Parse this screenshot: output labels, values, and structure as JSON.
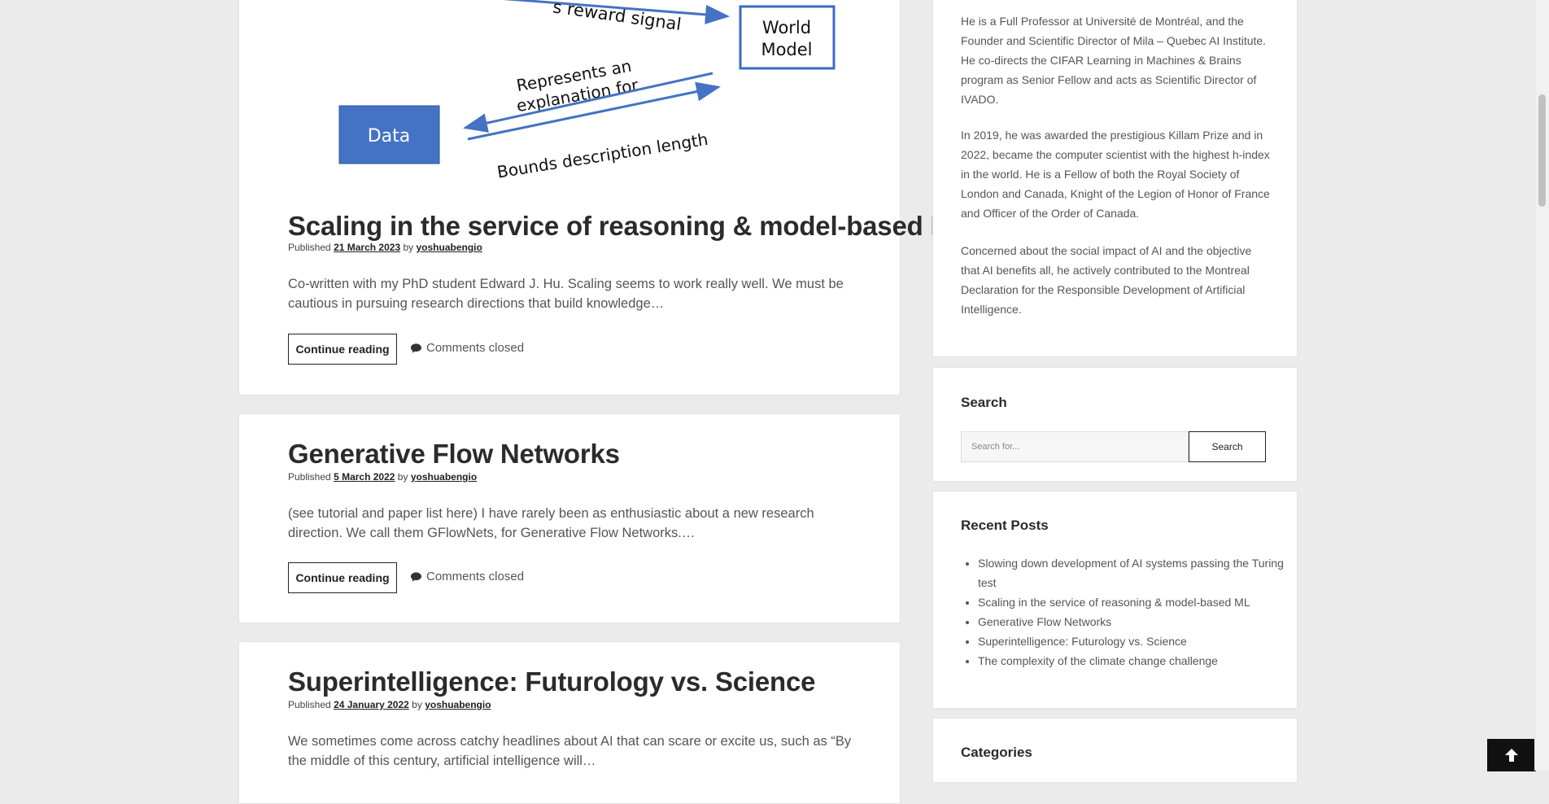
{
  "figure": {
    "world_model_line1": "World",
    "world_model_line2": "Model",
    "reward_signal_label": "s reward signal",
    "represents_line1": "Represents an",
    "represents_line2": "explanation for",
    "data_label": "Data",
    "bounds_label": "Bounds description length",
    "box_stroke_color": "#3b6bc2",
    "data_fill_color": "#4472c4",
    "arrow_color": "#4472c4"
  },
  "posts": [
    {
      "title": "Scaling in the service of reasoning & model-based ML",
      "published_label": "Published",
      "date": "21 March 2023",
      "by_label": "by",
      "author": "yoshuabengio",
      "excerpt": "Co-written with my PhD student Edward J. Hu. Scaling seems to work really well. We must be cautious in pursuing research directions that build knowledge…",
      "continue_label": "Continue reading",
      "comments_label": "Comments closed"
    },
    {
      "title": "Generative Flow Networks",
      "published_label": "Published",
      "date": "5 March 2022",
      "by_label": "by",
      "author": "yoshuabengio",
      "excerpt": "(see tutorial and paper list here) I have rarely been as enthusiastic about a new research direction. We call them GFlowNets, for Generative Flow Networks.…",
      "continue_label": "Continue reading",
      "comments_label": "Comments closed"
    },
    {
      "title": "Superintelligence: Futurology vs. Science",
      "published_label": "Published",
      "date": "24 January 2022",
      "by_label": "by",
      "author": "yoshuabengio",
      "excerpt": "We sometimes come across catchy headlines about AI that can scare or excite us, such as “By the middle of this century, artificial intelligence will…"
    }
  ],
  "sidebar": {
    "about_paragraphs": [
      "He is a Full Professor at Université de Montréal, and the Founder and Scientific Director of Mila – Quebec AI Institute. He co-directs the CIFAR Learning in Machines & Brains program as Senior Fellow and acts as Scientific Director of IVADO.",
      "In 2019, he was awarded the prestigious Killam Prize and in 2022, became the computer scientist with the highest h-index in the world. He is a Fellow of both the Royal Society of London and Canada, Knight of the Legion of Honor of France and Officer of the Order of Canada.",
      "Concerned about the social impact of AI and the objective that AI benefits all, he actively contributed to the Montreal Declaration for the Responsible Development of Artificial Intelligence."
    ],
    "search": {
      "title": "Search",
      "placeholder": "Search for...",
      "button_label": "Search"
    },
    "recent_posts": {
      "title": "Recent Posts",
      "items": [
        "Slowing down development of AI systems passing the Turing test",
        "Scaling in the service of reasoning & model-based ML",
        "Generative Flow Networks",
        "Superintelligence: Futurology vs. Science",
        "The complexity of the climate change challenge"
      ]
    },
    "categories": {
      "title": "Categories"
    }
  },
  "icons": {
    "comment": "comment-bubble-icon",
    "back_to_top": "arrow-up-icon"
  }
}
